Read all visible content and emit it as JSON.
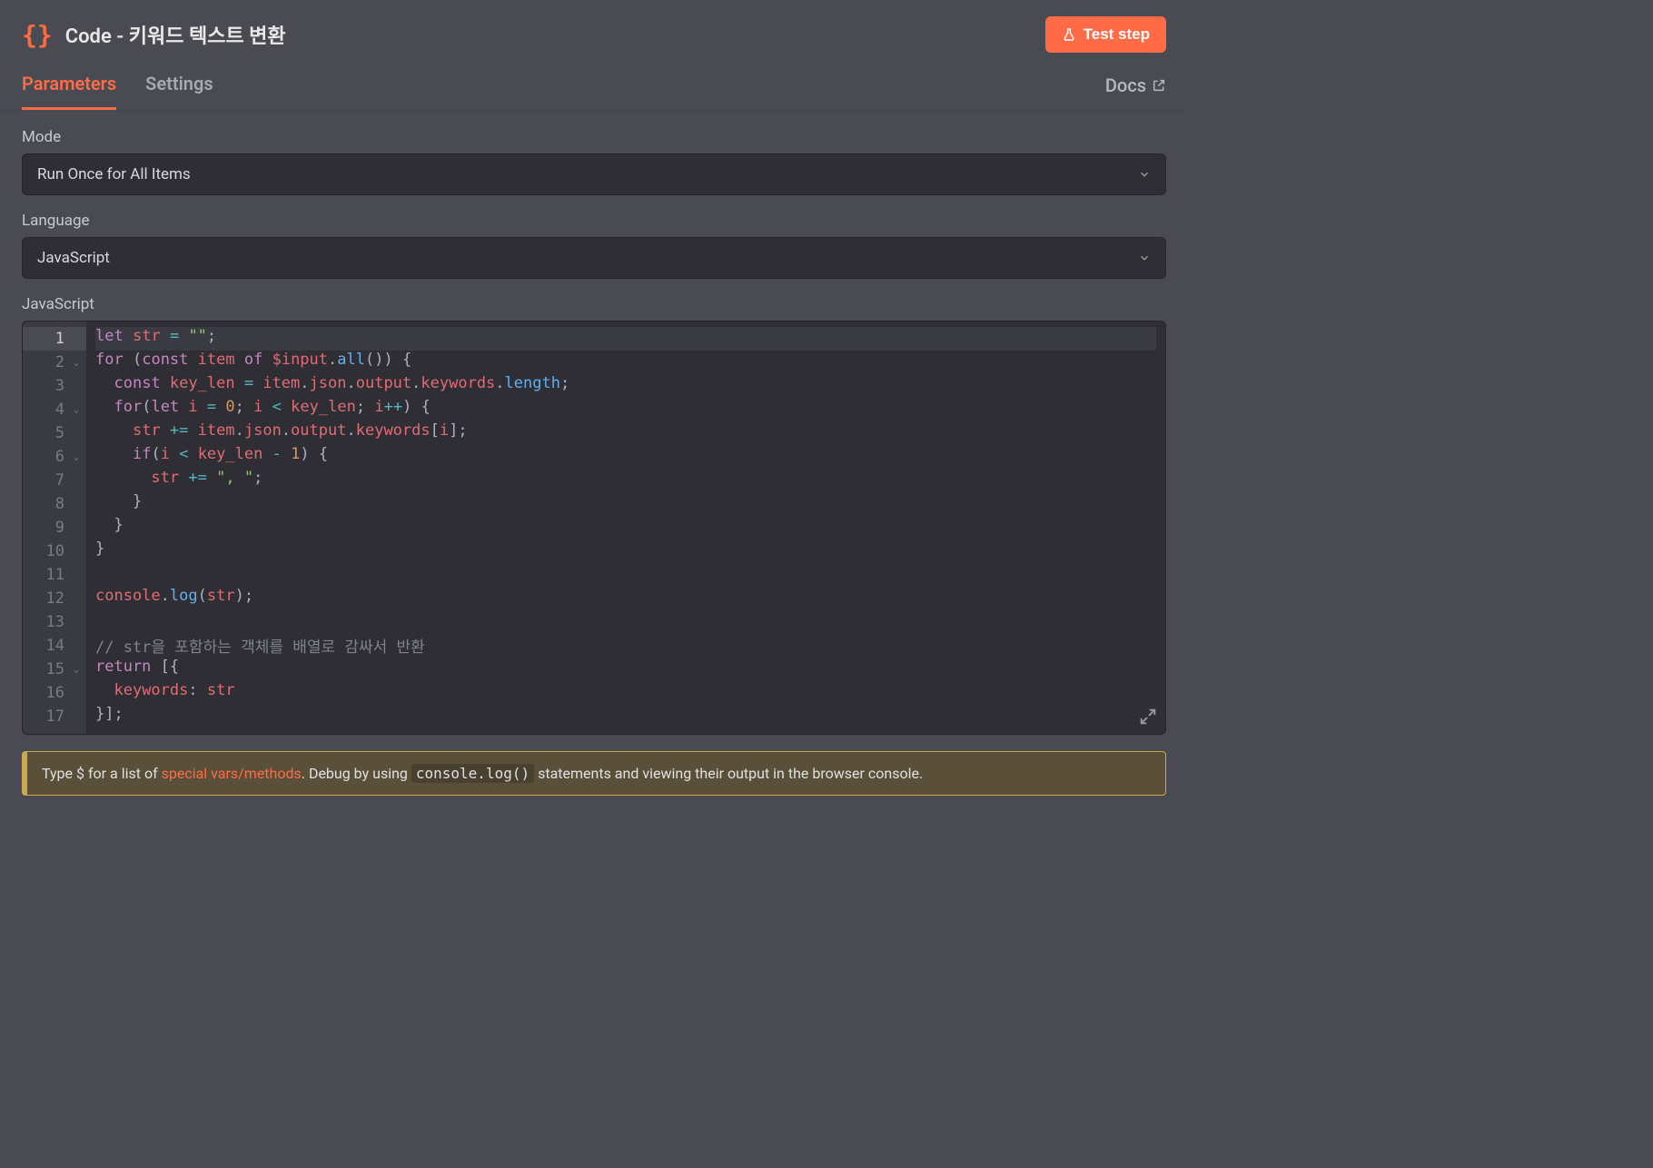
{
  "header": {
    "title": "Code - 키워드 텍스트 변환",
    "test_button": "Test step"
  },
  "tabs": {
    "parameters": "Parameters",
    "settings": "Settings",
    "docs": "Docs"
  },
  "fields": {
    "mode_label": "Mode",
    "mode_value": "Run Once for All Items",
    "language_label": "Language",
    "language_value": "JavaScript",
    "code_label": "JavaScript"
  },
  "code": {
    "lines": [
      "let str = \"\";",
      "for (const item of $input.all()) {",
      "  const key_len = item.json.output.keywords.length;",
      "  for(let i = 0; i < key_len; i++) {",
      "    str += item.json.output.keywords[i];",
      "    if(i < key_len - 1) {",
      "      str += \", \";",
      "    }",
      "  }",
      "}",
      "",
      "console.log(str);",
      "",
      "// str을 포함하는 객체를 배열로 감싸서 반환",
      "return [{",
      "  keywords: str",
      "}];"
    ],
    "fold_lines": [
      2,
      4,
      6,
      15
    ],
    "highlighted_line": 1
  },
  "hint": {
    "prefix": "Type $ for a list of ",
    "link": "special vars/methods",
    "middle": ". Debug by using ",
    "code": "console.log()",
    "suffix": " statements and viewing their output in the browser console."
  }
}
